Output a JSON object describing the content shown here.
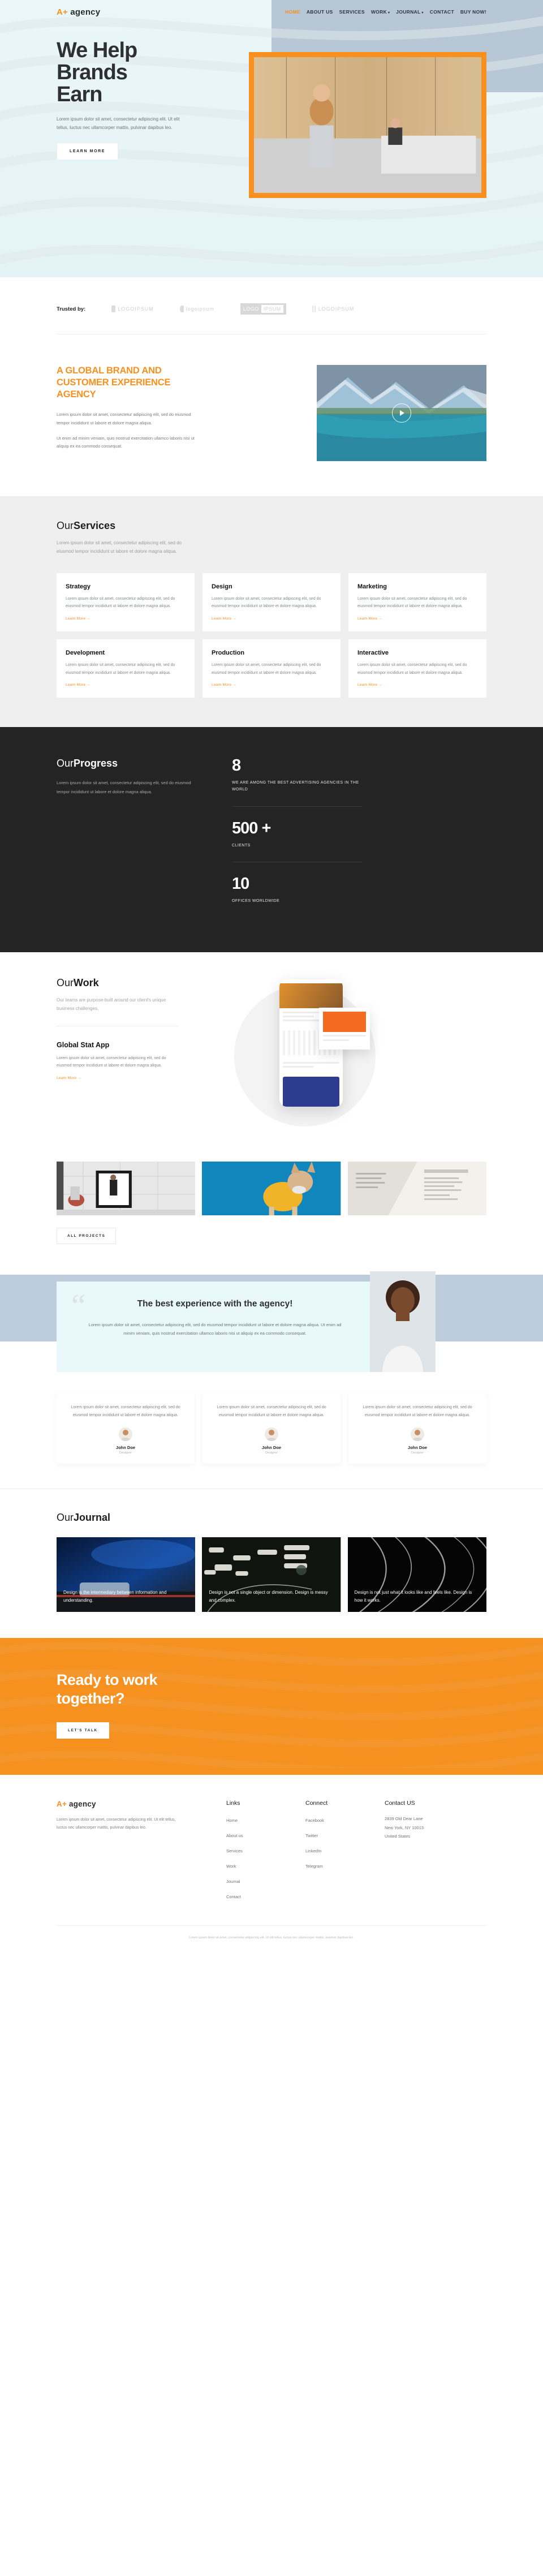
{
  "brand": {
    "plus": "A+",
    "name": "agency"
  },
  "nav": [
    {
      "label": "HOME",
      "active": true,
      "caret": false
    },
    {
      "label": "ABOUT US",
      "active": false,
      "caret": false
    },
    {
      "label": "SERVICES",
      "active": false,
      "caret": false
    },
    {
      "label": "WORK",
      "active": false,
      "caret": true
    },
    {
      "label": "JOURNAL",
      "active": false,
      "caret": true
    },
    {
      "label": "CONTACT",
      "active": false,
      "caret": false
    },
    {
      "label": "BUY NOW!",
      "active": false,
      "caret": false
    }
  ],
  "hero": {
    "title_line1": "We Help",
    "title_line2": "Brands",
    "title_line3": "Earn",
    "subtitle": "Lorem ipsum dolor sit amet, consectetur adipiscing elit. Ut elit tellus, luctus nec ullamcorper mattis, pulvinar dapibus leo.",
    "cta": "LEARN MORE"
  },
  "trusted": {
    "label": "Trusted by:",
    "logos": [
      {
        "text": "LOGOIPSUM",
        "style": "plain"
      },
      {
        "text": "logoipsum",
        "style": "plain"
      },
      {
        "text": "LOGO",
        "text2": "IPSUM",
        "style": "boxed"
      },
      {
        "text": "LOGOIPSUM",
        "style": "plain"
      }
    ]
  },
  "global": {
    "heading": "A GLOBAL BRAND AND CUSTOMER EXPERIENCE AGENCY",
    "p1": "Lorem ipsum dolor sit amet, consectetur adipiscing elit, sed do eiusmod tempor incididunt ut labore et dolore magna aliqua.",
    "p2": "Ut enim ad minim veniam, quis nostrud exercitation ullamco laboris nisi ut aliquip ex ea commodo consequat.",
    "video_icon": "play-icon"
  },
  "services": {
    "title_light": "Our",
    "title_bold": "Services",
    "subtitle": "Lorem ipsum dolor sit amet, consectetur adipiscing elit, sed do eiusmod tempor incididunt ut labore et dolore magna aliqua.",
    "card_body": "Lorem ipsum dolor sit amet, consectetur adipiscing elit, sed do eiusmod tempor incididunt ut labore et dolore magna aliqua.",
    "more_label": "Learn More →",
    "cards": [
      {
        "title": "Strategy"
      },
      {
        "title": "Design"
      },
      {
        "title": "Marketing"
      },
      {
        "title": "Development"
      },
      {
        "title": "Production"
      },
      {
        "title": "Interactive"
      }
    ]
  },
  "progress": {
    "title_light": "Our",
    "title_bold": "Progress",
    "paragraph": "Lorem ipsum dolor sit amet, consectetur adipiscing elit, sed do eiusmod tempor incididunt ut labore et dolore magna aliqua.",
    "stats": [
      {
        "number": "8",
        "label": "WE ARE AMONG THE BEST ADVERTISING AGENCIES IN THE WORLD"
      },
      {
        "number": "500 +",
        "label": "CLIENTS"
      },
      {
        "number": "10",
        "label": "OFFICES WORLDWIDE"
      }
    ]
  },
  "work": {
    "title_light": "Our",
    "title_bold": "Work",
    "lead": "Our teams are purpose-built around our client's unique business challenges,",
    "project_title": "Global Stat App",
    "project_body": "Lorem ipsum dolor sit amet, consectetur adipiscing elit, sed do eiusmod tempor incididunt ut labore et dolore magna aliqua.",
    "more_label": "Learn More →",
    "all_projects": "ALL PROJECTS"
  },
  "testimonial": {
    "quote_mark": "“",
    "heading": "The best experience with the agency!",
    "body": "Lorem ipsum dolor sit amet, consectetur adipiscing elit, sed do eiusmod tempor incididunt ut labore et dolore magna aliqua. Ut enim ad minim veniam, quis nostrud exercitation ullamco laboris nisi ut aliquip ex ea commodo consequat.",
    "cards": [
      {
        "text": "Lorem ipsum dolor sit amet, consectetur adipiscing elit, sed do eiusmod tempor incididunt ut labore et dolore magna aliqua.",
        "name": "John Doe",
        "role": "Designer"
      },
      {
        "text": "Lorem ipsum dolor sit amet, consectetur adipiscing elit, sed do eiusmod tempor incididunt ut labore et dolore magna aliqua.",
        "name": "John Doe",
        "role": "Designer"
      },
      {
        "text": "Lorem ipsum dolor sit amet, consectetur adipiscing elit, sed do eiusmod tempor incididunt ut labore et dolore magna aliqua.",
        "name": "John Doe",
        "role": "Designer"
      }
    ]
  },
  "journal": {
    "title_light": "Our",
    "title_bold": "Journal",
    "cards": [
      {
        "text": "Design is the intermediary between information and understanding."
      },
      {
        "text": "Design is not a single object or dimension. Design is messy and complex."
      },
      {
        "text": "Design is not just what it looks like and feels like. Design is how it works."
      }
    ]
  },
  "cta": {
    "heading_line1": "Ready to work",
    "heading_line2": "together?",
    "button": "LET'S TALK"
  },
  "footer": {
    "about": "Lorem ipsum dolor sit amet, consectetur adipiscing elit. Ut elit tellus, luctus nec ullamcorper mattis, pulvinar dapibus leo.",
    "links_title": "Links",
    "links": [
      "Home",
      "About us",
      "Services",
      "Work",
      "Journal",
      "Contact"
    ],
    "connect_title": "Connect",
    "connect": [
      "Facebook",
      "Twitter",
      "LinkedIn",
      "Telegram"
    ],
    "contact_title": "Contact US",
    "address_line1": "2839 Old Dear Lane",
    "address_line2": "New York, NY 10013",
    "address_line3": "United States",
    "copyright": "Lorem ipsum dolor sit amet, consectetur adipiscing elit. Ut elit tellus, luctus nec ullamcorper mattis, pulvinar dapibus leo."
  },
  "colors": {
    "accent": "#f7901e",
    "dark": "#242424",
    "hero_bg": "#eaf6f8",
    "band": "#bcccdc",
    "quote_bg": "#e9f8fb"
  }
}
